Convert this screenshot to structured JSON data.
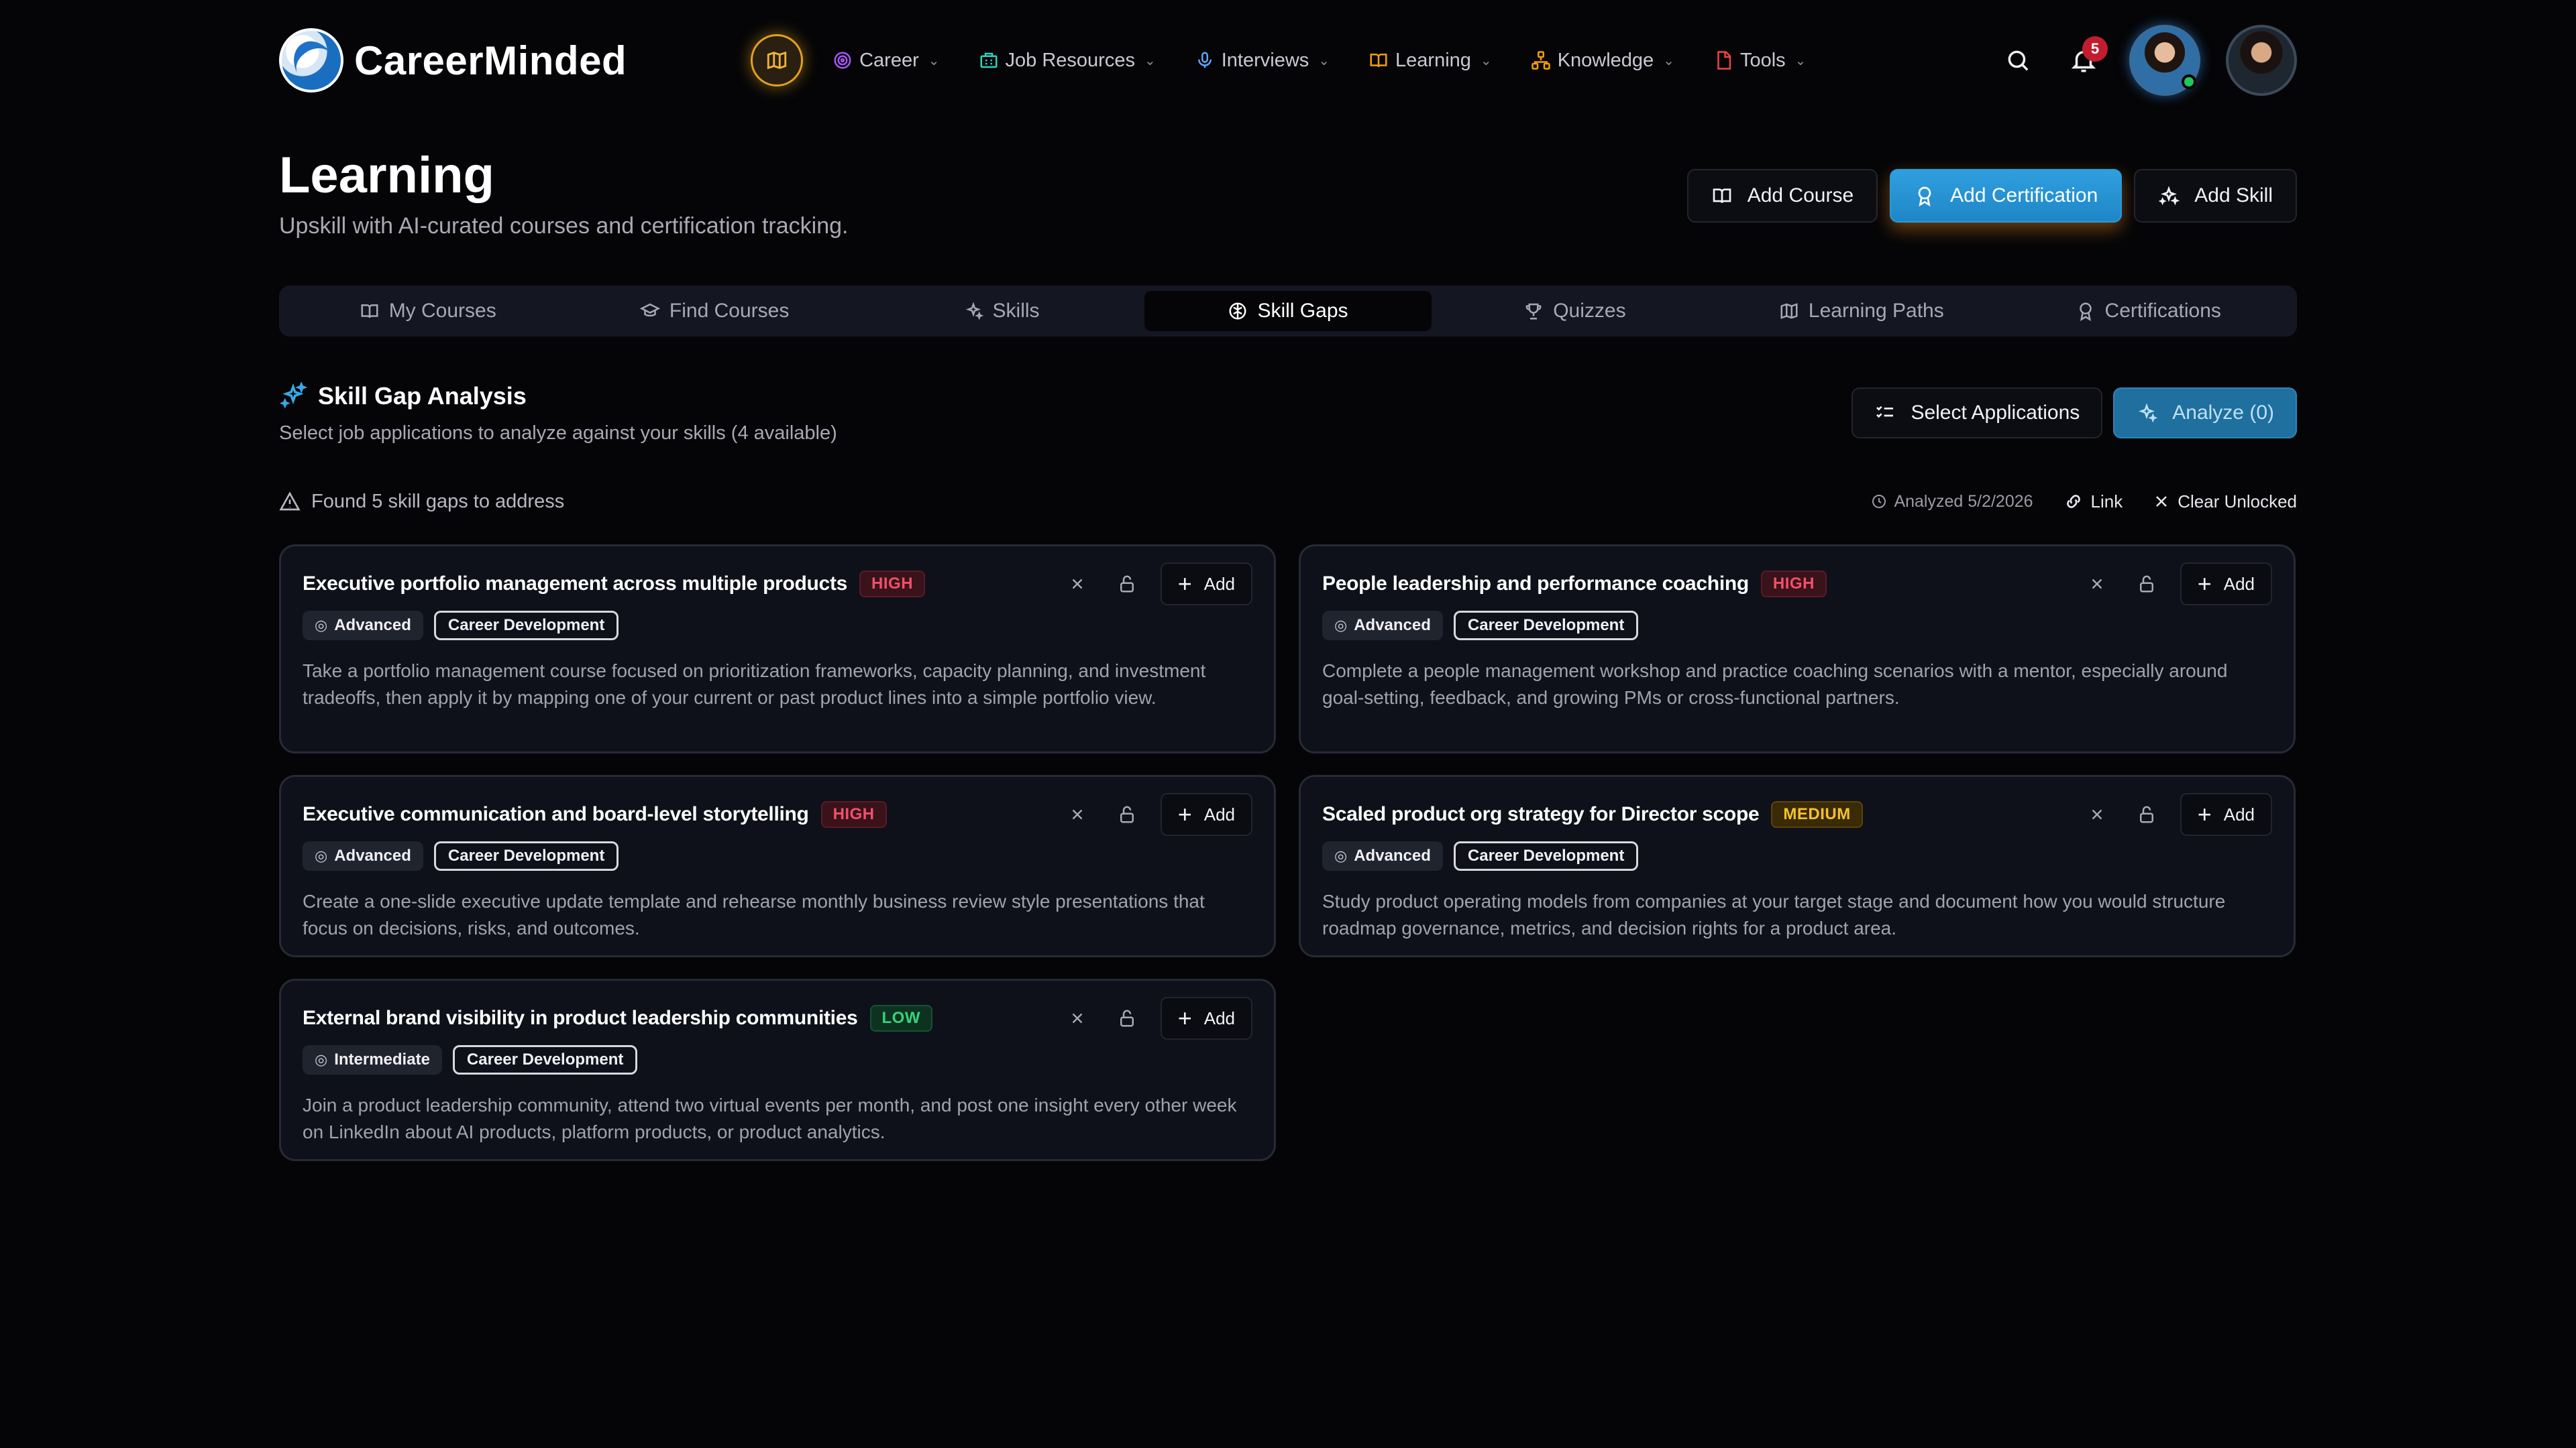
{
  "app": {
    "name": "CareerMinded"
  },
  "nav": {
    "items": [
      {
        "label": "Career",
        "icon": "target-icon",
        "color": "#a855f7"
      },
      {
        "label": "Job Resources",
        "icon": "building-icon",
        "color": "#2dd4bf"
      },
      {
        "label": "Interviews",
        "icon": "microphone-icon",
        "color": "#60a5fa"
      },
      {
        "label": "Learning",
        "icon": "book-icon",
        "color": "#f59e0b"
      },
      {
        "label": "Knowledge",
        "icon": "network-icon",
        "color": "#f59e0b"
      },
      {
        "label": "Tools",
        "icon": "document-icon",
        "color": "#ef4444"
      }
    ]
  },
  "notifications": {
    "count": "5"
  },
  "page": {
    "title": "Learning",
    "subtitle": "Upskill with AI-curated courses and certification tracking."
  },
  "actions": {
    "add_course": "Add Course",
    "add_certification": "Add Certification",
    "add_skill": "Add Skill"
  },
  "tabs": [
    {
      "label": "My Courses",
      "icon": "book-icon"
    },
    {
      "label": "Find Courses",
      "icon": "graduation-cap-icon"
    },
    {
      "label": "Skills",
      "icon": "sparkles-icon"
    },
    {
      "label": "Skill Gaps",
      "icon": "brain-icon",
      "active": true
    },
    {
      "label": "Quizzes",
      "icon": "trophy-icon"
    },
    {
      "label": "Learning Paths",
      "icon": "map-icon"
    },
    {
      "label": "Certifications",
      "icon": "award-icon"
    }
  ],
  "section": {
    "title": "Skill Gap Analysis",
    "subtitle": "Select job applications to analyze against your skills (4 available)",
    "select_applications": "Select Applications",
    "analyze": "Analyze (0)",
    "found": "Found 5 skill gaps to address",
    "analyzed": "Analyzed 5/2/2026",
    "link": "Link",
    "clear_unlocked": "Clear Unlocked"
  },
  "card_labels": {
    "add": "Add"
  },
  "cards": [
    {
      "title": "Executive portfolio management across multiple products",
      "priority": "HIGH",
      "level": "Advanced",
      "category": "Career Development",
      "description": "Take a portfolio management course focused on prioritization frameworks, capacity planning, and investment tradeoffs, then apply it by mapping one of your current or past product lines into a simple portfolio view."
    },
    {
      "title": "People leadership and performance coaching",
      "priority": "HIGH",
      "level": "Advanced",
      "category": "Career Development",
      "description": "Complete a people management workshop and practice coaching scenarios with a mentor, especially around goal-setting, feedback, and growing PMs or cross-functional partners."
    },
    {
      "title": "Executive communication and board-level storytelling",
      "priority": "HIGH",
      "level": "Advanced",
      "category": "Career Development",
      "description": "Create a one-slide executive update template and rehearse monthly business review style presentations that focus on decisions, risks, and outcomes."
    },
    {
      "title": "Scaled product org strategy for Director scope",
      "priority": "MEDIUM",
      "level": "Advanced",
      "category": "Career Development",
      "description": "Study product operating models from companies at your target stage and document how you would structure roadmap governance, metrics, and decision rights for a product area."
    },
    {
      "title": "External brand visibility in product leadership communities",
      "priority": "LOW",
      "level": "Intermediate",
      "category": "Career Development",
      "description": "Join a product leadership community, attend two virtual events per month, and post one insight every other week on LinkedIn about AI products, platform products, or product analytics."
    }
  ]
}
